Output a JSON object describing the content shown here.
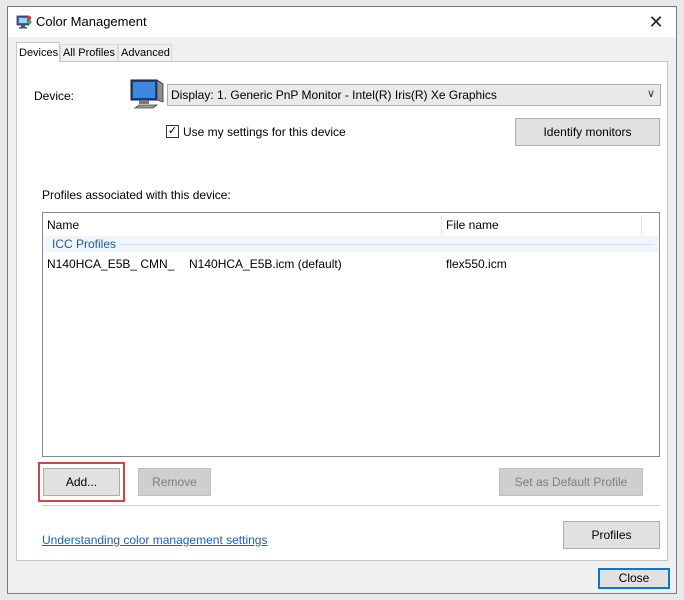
{
  "window": {
    "title": "Color Management"
  },
  "tabs": [
    "Devices",
    "All Profiles",
    "Advanced"
  ],
  "device": {
    "label": "Device:",
    "selected": "Display: 1. Generic PnP Monitor - Intel(R) Iris(R) Xe Graphics",
    "use_my_settings_label": "Use my settings for this device",
    "use_my_settings_checked": true,
    "identify_button": "Identify monitors"
  },
  "profiles": {
    "section_label": "Profiles associated with this device:",
    "columns": [
      "Name",
      "File name"
    ],
    "group": "ICC Profiles",
    "rows": [
      {
        "name": "N140HCA_E5B_ CMN_",
        "col2": "N140HCA_E5B.icm (default)",
        "file": "flex550.icm"
      }
    ]
  },
  "buttons": {
    "add": "Add...",
    "remove": "Remove",
    "set_default": "Set as Default Profile",
    "profiles": "Profiles",
    "close": "Close"
  },
  "link": {
    "text": "Understanding color management settings"
  },
  "colors": {
    "highlight": "#d14545",
    "link": "#1a62b5",
    "accent": "#0078d7"
  }
}
